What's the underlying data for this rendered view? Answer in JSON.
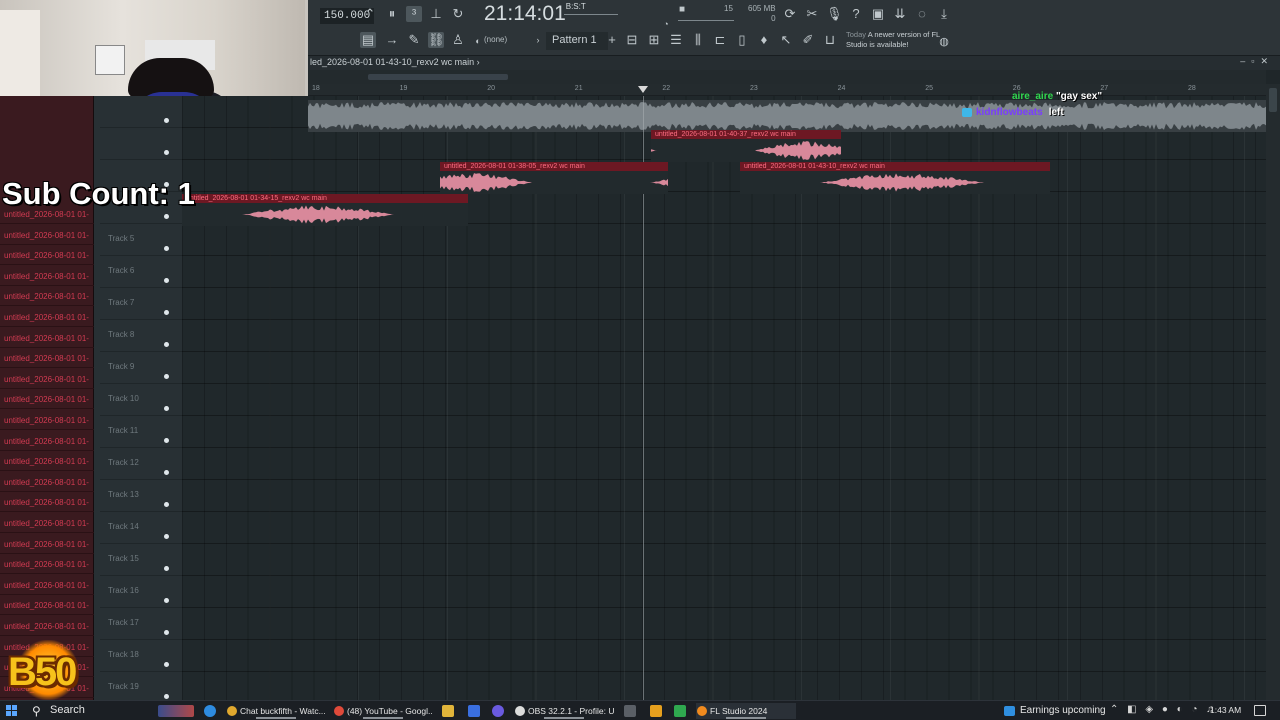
{
  "toolbar": {
    "tempo": "150.000",
    "clock": "21:14:01",
    "clock_sub": "B:S:T",
    "cpu": "15",
    "memory": "605 MB",
    "voices": "0",
    "pattern": "Pattern 1",
    "channel_select": "(none)",
    "news_day": "Today",
    "news_text": "A newer version of FL Studio is available!"
  },
  "playlist": {
    "title": "led_2026-08-01 01-43-10_rexv2 wc main",
    "ruler_marks": [
      "18",
      "19",
      "20",
      "21",
      "22",
      "23",
      "24",
      "25",
      "26",
      "27",
      "28"
    ],
    "tracks": [
      {
        "name": "Track 5"
      },
      {
        "name": "Track 6"
      },
      {
        "name": "Track 7"
      },
      {
        "name": "Track 8"
      },
      {
        "name": "Track 9"
      },
      {
        "name": "Track 10"
      },
      {
        "name": "Track 11"
      },
      {
        "name": "Track 12"
      },
      {
        "name": "Track 13"
      },
      {
        "name": "Track 14"
      },
      {
        "name": "Track 15"
      },
      {
        "name": "Track 16"
      },
      {
        "name": "Track 17"
      },
      {
        "name": "Track 18"
      },
      {
        "name": "Track 19"
      }
    ],
    "picker_item": "untitled_2026-08-01 01-",
    "clips": [
      {
        "label": "untitled_2026-08-01 01-40-37_rexv2 wc main"
      },
      {
        "label": "untitled_2026-08-01 01-38-05_rexv2 wc main"
      },
      {
        "label": "untitled_2026-08-01 01-43-10_rexv2 wc main"
      },
      {
        "label": "untitled_2026-08-01 01-34-15_rexv2 wc main"
      }
    ]
  },
  "overlay": {
    "sub_count": "Sub Count: 1",
    "chat": [
      {
        "user": "aire_aire",
        "message": "\"gay sex\""
      },
      {
        "user": "kidnflowbeats",
        "message": "left"
      }
    ],
    "logo": "B50"
  },
  "taskbar": {
    "search": "Search",
    "tasks": [
      {
        "label": "Chat buckfifth - Watc..."
      },
      {
        "label": "(48) YouTube - Googl..."
      },
      {
        "label": "OBS 32.2.1 - Profile: U..."
      },
      {
        "label": "FL Studio 2024"
      }
    ],
    "weather": "Earnings upcoming",
    "time": "1:43 AM"
  },
  "colors": {
    "clip_header": "#6d1823",
    "clip_wave": "#d8889a",
    "chat_user_1": "#31d84f",
    "chat_user_2": "#7a3cff"
  }
}
